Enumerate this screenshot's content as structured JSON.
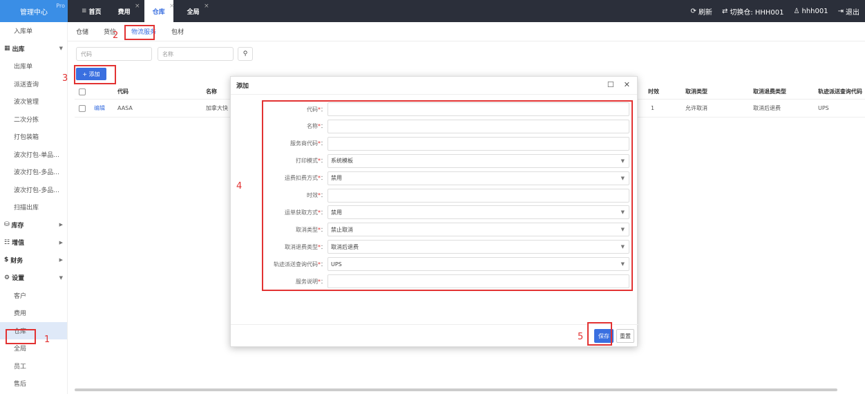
{
  "brand": {
    "title": "管理中心",
    "badge": "Pro"
  },
  "top_tabs": [
    {
      "label": "首页",
      "icon": "home-icon"
    },
    {
      "label": "费用"
    },
    {
      "label": "仓库"
    },
    {
      "label": "全局"
    }
  ],
  "top_right": {
    "refresh": "刷新",
    "switch": "切换仓: HHH001",
    "user": "hhh001",
    "logout": "退出"
  },
  "sidebar": {
    "items": [
      {
        "label": "入库单"
      },
      {
        "label": "出库",
        "group": true
      },
      {
        "label": "出库单"
      },
      {
        "label": "派送查询"
      },
      {
        "label": "波次管理"
      },
      {
        "label": "二次分拣"
      },
      {
        "label": "打包装箱"
      },
      {
        "label": "波次打包-单品..."
      },
      {
        "label": "波次打包-多品..."
      },
      {
        "label": "波次打包-多品..."
      },
      {
        "label": "扫描出库"
      },
      {
        "label": "库存",
        "group": true
      },
      {
        "label": "增值",
        "group": true
      },
      {
        "label": "财务",
        "group": true
      },
      {
        "label": "设置",
        "group": true
      },
      {
        "label": "客户"
      },
      {
        "label": "费用"
      },
      {
        "label": "仓库"
      },
      {
        "label": "全局"
      },
      {
        "label": "员工"
      },
      {
        "label": "售后"
      }
    ]
  },
  "subtabs": [
    "仓储",
    "货位",
    "物流服务",
    "包材"
  ],
  "search": {
    "code_placeholder": "代码",
    "name_placeholder": "名称"
  },
  "add_button": "+ 添加",
  "table": {
    "headers": [
      "代码",
      "名称",
      "时效",
      "取消类型",
      "取消退费类型",
      "轨迹派送查询代码"
    ],
    "row": {
      "action": "编辑",
      "code": "AASA",
      "name": "加拿大快",
      "time": "1",
      "cancel_type": "允许取消",
      "refund_type": "取消后退费",
      "track": "UPS"
    }
  },
  "modal": {
    "title": "添加",
    "fields": [
      {
        "label": "代码",
        "required": true,
        "value": "",
        "select": false
      },
      {
        "label": "名称",
        "required": true,
        "value": "",
        "select": false
      },
      {
        "label": "服务商代码",
        "required": true,
        "value": "",
        "select": false
      },
      {
        "label": "打印模式",
        "required": true,
        "value": "系统模板",
        "select": true
      },
      {
        "label": "运费扣费方式",
        "required": true,
        "value": "禁用",
        "select": true
      },
      {
        "label": "时效",
        "required": true,
        "value": "",
        "select": false
      },
      {
        "label": "运单获取方式",
        "required": true,
        "value": "禁用",
        "select": true
      },
      {
        "label": "取消类型",
        "required": true,
        "value": "禁止取消",
        "select": true
      },
      {
        "label": "取消退费类型",
        "required": true,
        "value": "取消后退费",
        "select": true
      },
      {
        "label": "轨迹派送查询代码",
        "required": true,
        "value": "UPS",
        "select": true
      },
      {
        "label": "服务说明",
        "required": true,
        "value": "",
        "select": false
      }
    ],
    "save": "保存",
    "reset": "重置"
  },
  "annotations": [
    "1",
    "2",
    "3",
    "4",
    "5"
  ]
}
